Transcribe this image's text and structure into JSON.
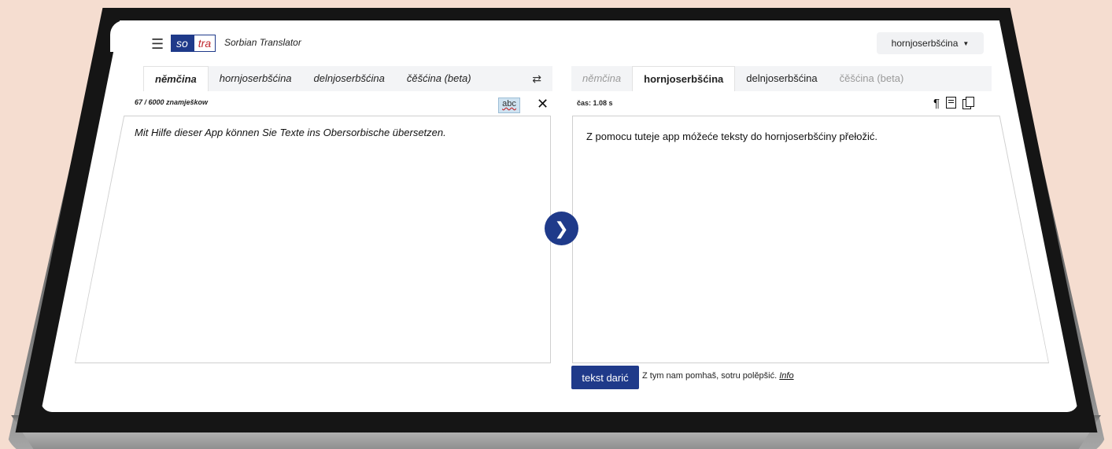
{
  "header": {
    "logo_left": "so",
    "logo_right": "tra",
    "title": "Sorbian Translator",
    "ui_language": "hornjoserbšćina"
  },
  "source": {
    "tabs": [
      {
        "label": "němčina",
        "active": true
      },
      {
        "label": "hornjoserbšćina",
        "active": false
      },
      {
        "label": "delnjoserbšćina",
        "active": false
      },
      {
        "label": "čěšćina (beta)",
        "active": false
      }
    ],
    "char_count": "67 / 6000 znamješkow",
    "spell_label": "abc",
    "text": "Mit Hilfe dieser App können Sie Texte ins Obersorbische übersetzen."
  },
  "target": {
    "tabs": [
      {
        "label": "němčina",
        "active": false
      },
      {
        "label": "hornjoserbšćina",
        "active": true
      },
      {
        "label": "delnjoserbšćina",
        "active": false
      },
      {
        "label": "čěšćina (beta)",
        "active": false
      }
    ],
    "time": "čas: 1.08 s",
    "text": "Z pomocu tuteje app móžeće teksty do hornjoserbšćiny přełožić."
  },
  "feedback": {
    "button_label": "tekst darić",
    "text": "Z tym nam pomhaš, sotru polěpšić.",
    "link": "Info"
  },
  "colors": {
    "brand": "#1f3a8a",
    "accent_red": "#c0272d"
  }
}
